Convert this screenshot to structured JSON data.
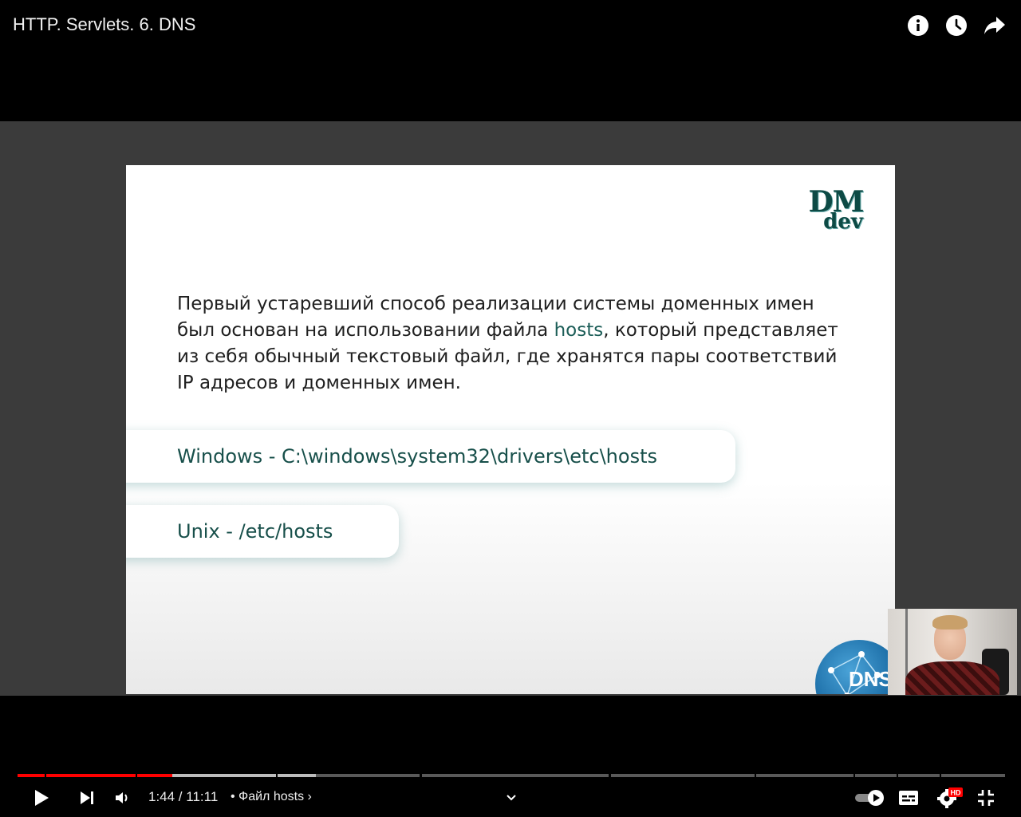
{
  "video": {
    "title": "HTTP. Servlets. 6. DNS"
  },
  "top_actions": [
    {
      "icon": "info-icon"
    },
    {
      "icon": "clock-icon"
    },
    {
      "icon": "share-icon"
    }
  ],
  "slide": {
    "logo_top": "DM",
    "logo_bottom": "dev",
    "paragraph_before": "Первый устаревший способ реализации системы доменных имен был основан на использовании файла ",
    "paragraph_highlight": "hosts",
    "paragraph_after": ", который представляет из себя обычный текстовый файл, где хранятся пары соответствий IP адресов и доменных имен.",
    "path_windows": "Windows - C:\\windows\\system32\\drivers\\etc\\hosts",
    "path_unix": "Unix - /etc/hosts",
    "globe_label": "DNS"
  },
  "player": {
    "time_display": "1:44 / 11:11",
    "chapter_label": "• Файл hosts ›",
    "progress_fraction": 0.156,
    "colors": {
      "played": "#ff0000",
      "accent": "#ffffff"
    }
  }
}
